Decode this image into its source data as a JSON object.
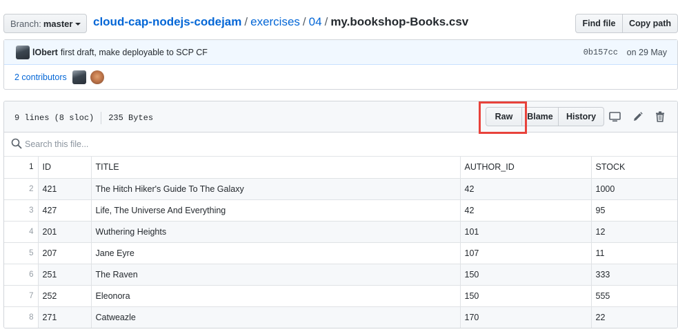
{
  "branch": {
    "label": "Branch:",
    "value": "master"
  },
  "breadcrumb": {
    "repo": "cloud-cap-nodejs-codejam",
    "separator": "/",
    "parts": [
      "exercises",
      "04"
    ],
    "file": "my.bookshop-Books.csv"
  },
  "header_buttons": {
    "find_file": "Find file",
    "copy_path": "Copy path"
  },
  "commit": {
    "author": "lObert",
    "message": "first draft, make deployable to SCP CF",
    "sha": "0b157cc",
    "date": "on 29 May"
  },
  "contributors": {
    "label": "2 contributors"
  },
  "file_info": {
    "lines": "9 lines (8 sloc)",
    "size": "235 Bytes"
  },
  "file_actions": {
    "raw": "Raw",
    "blame": "Blame",
    "history": "History"
  },
  "icons": [
    "desktop-icon",
    "pencil-icon",
    "trash-icon",
    "search-icon"
  ],
  "accent_colors": {
    "link": "#0366d6",
    "highlight": "#e8423b"
  },
  "search": {
    "placeholder": "Search this file..."
  },
  "table": {
    "line_numbers": [
      "1",
      "2",
      "3",
      "4",
      "5",
      "6",
      "7",
      "8"
    ],
    "columns": [
      "ID",
      "TITLE",
      "AUTHOR_ID",
      "STOCK"
    ],
    "rows": [
      [
        "421",
        "The Hitch Hiker's Guide To The Galaxy",
        "42",
        "1000"
      ],
      [
        "427",
        "Life, The Universe And Everything",
        "42",
        "95"
      ],
      [
        "201",
        "Wuthering Heights",
        "101",
        "12"
      ],
      [
        "207",
        "Jane Eyre",
        "107",
        "11"
      ],
      [
        "251",
        "The Raven",
        "150",
        "333"
      ],
      [
        "252",
        "Eleonora",
        "150",
        "555"
      ],
      [
        "271",
        "Catweazle",
        "170",
        "22"
      ]
    ]
  }
}
